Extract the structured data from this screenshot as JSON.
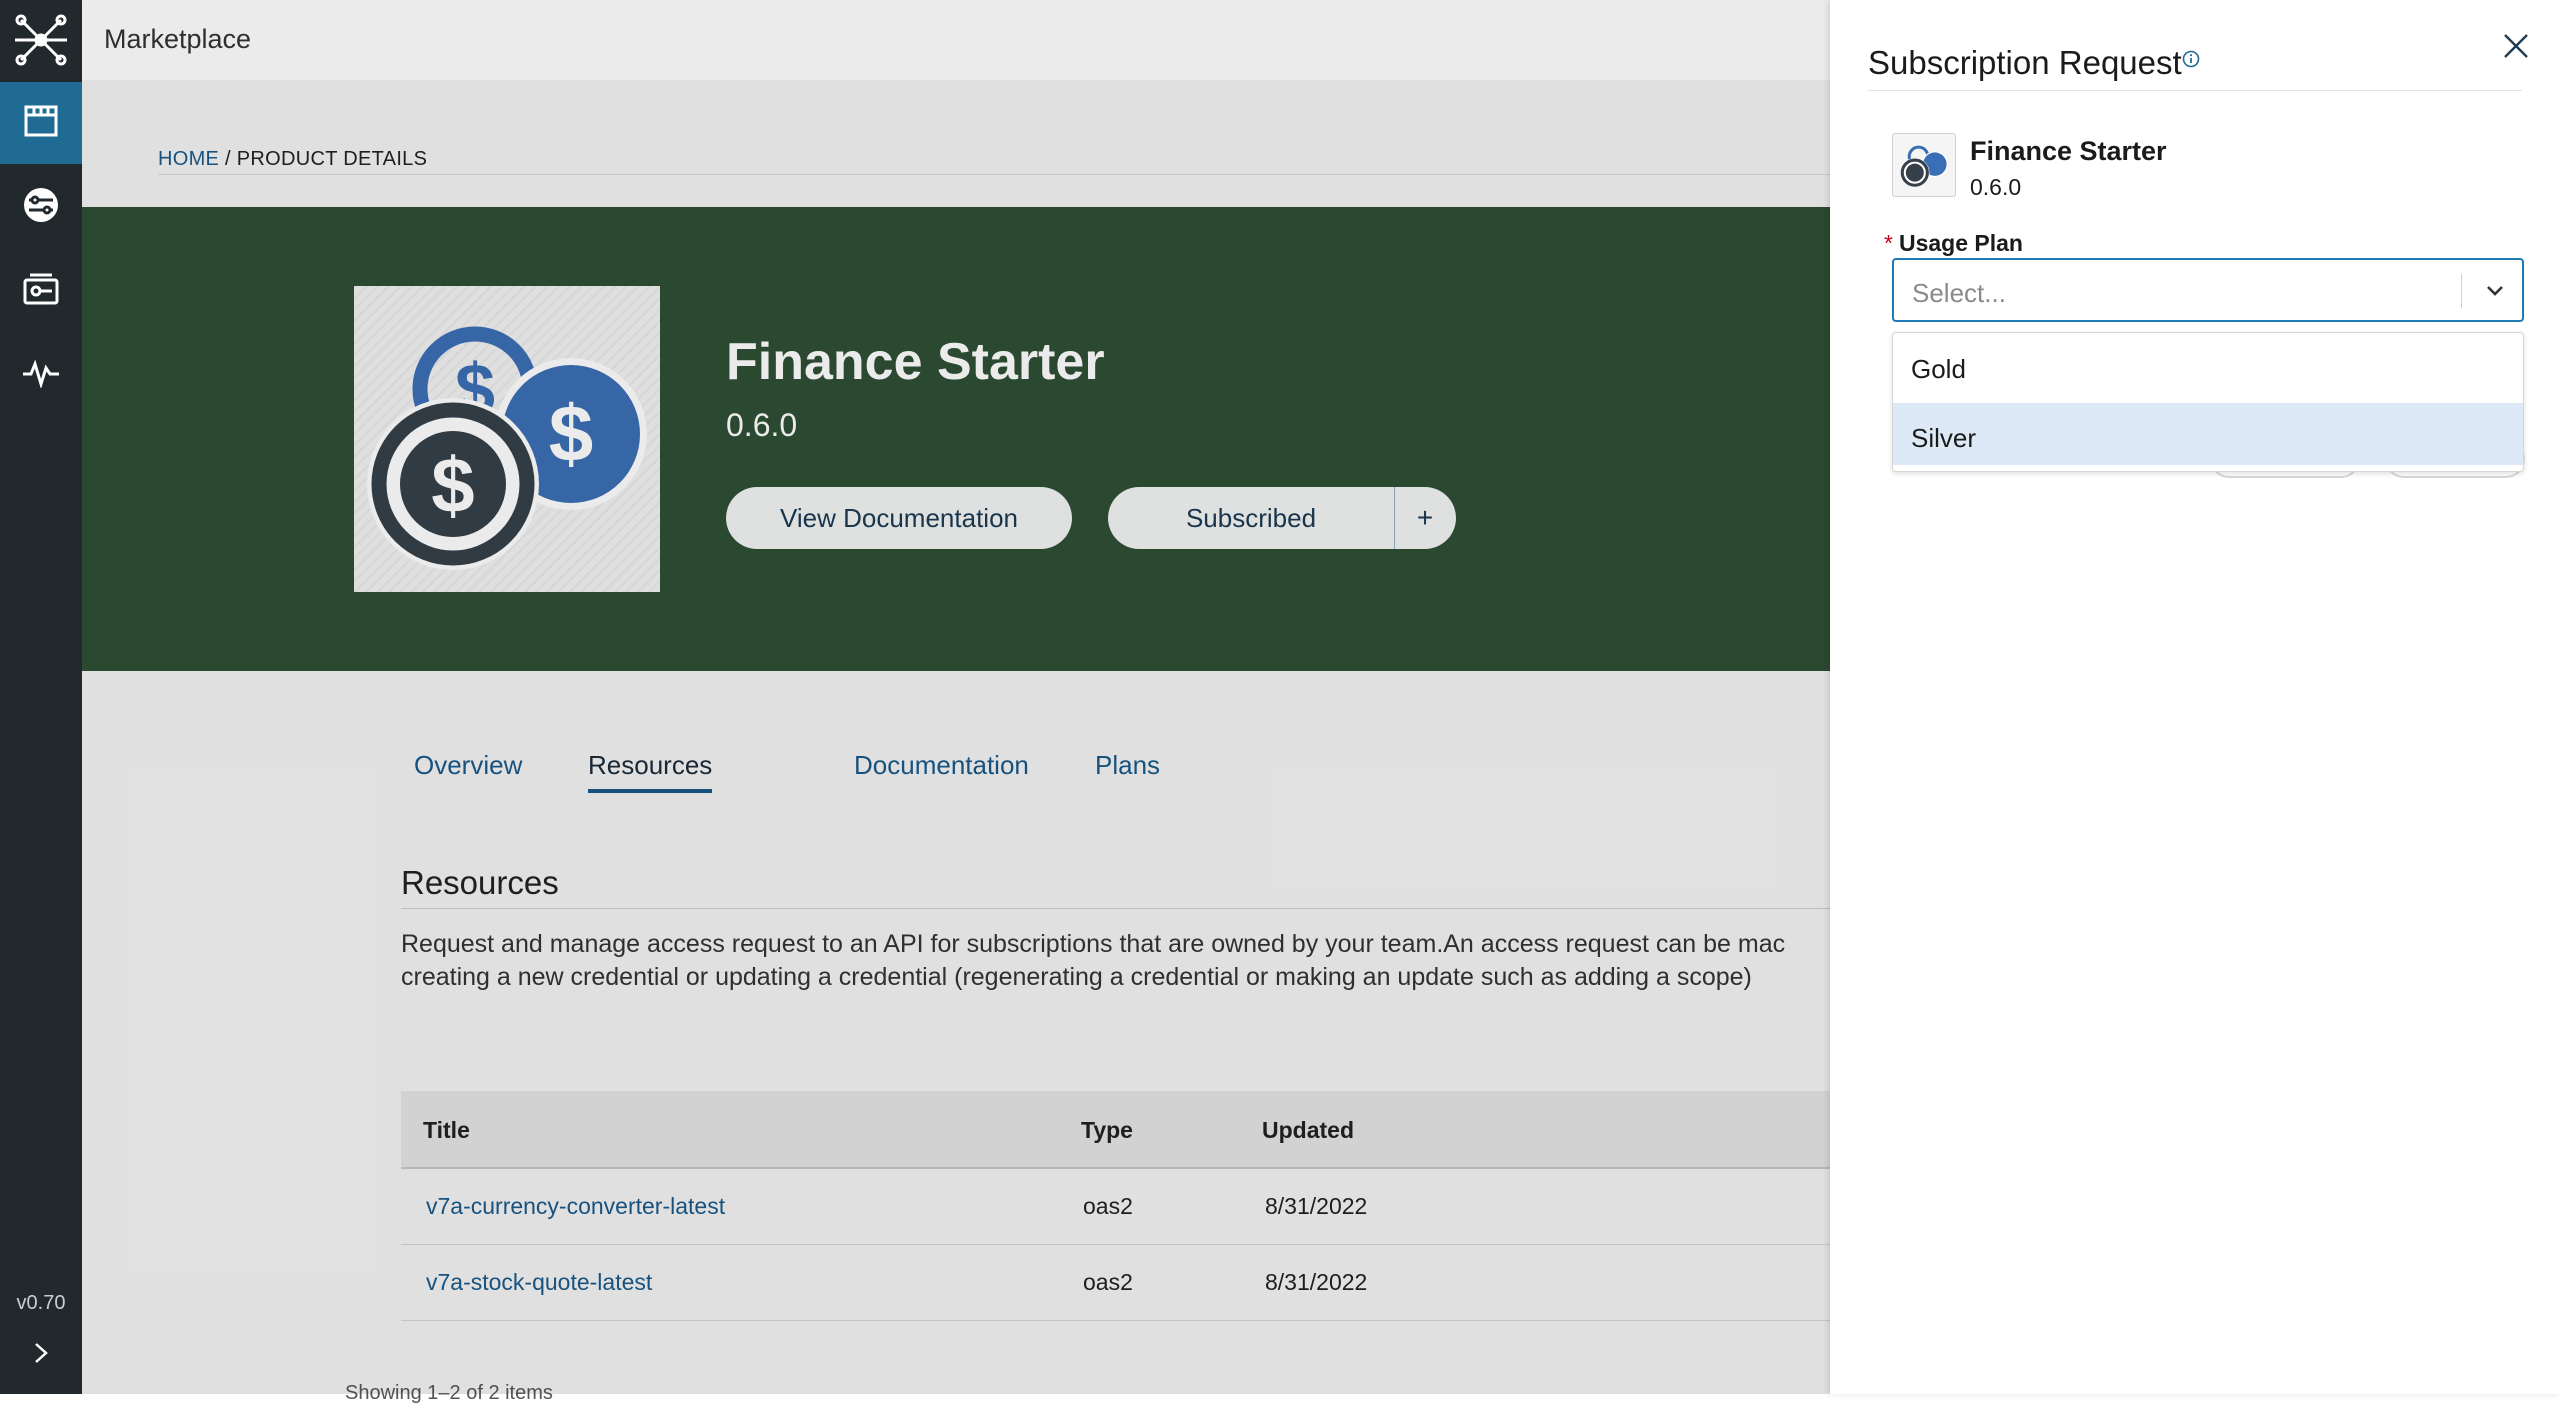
{
  "app": {
    "title": "Marketplace",
    "version": "v0.70"
  },
  "sidebar": {
    "items": [
      {
        "icon": "store-icon",
        "active": true
      },
      {
        "icon": "api-connection-icon",
        "active": false
      },
      {
        "icon": "credentials-icon",
        "active": false
      },
      {
        "icon": "activity-icon",
        "active": false
      }
    ]
  },
  "breadcrumb": {
    "home": "HOME",
    "separator": " / ",
    "current": "PRODUCT DETAILS"
  },
  "product": {
    "name": "Finance Starter",
    "version": "0.6.0",
    "view_docs_label": "View Documentation",
    "subscribed_label": "Subscribed",
    "add_label": "+"
  },
  "tabs": [
    {
      "label": "Overview",
      "active": false
    },
    {
      "label": "Resources",
      "active": true
    },
    {
      "label": "Documentation",
      "active": false
    },
    {
      "label": "Plans",
      "active": false
    }
  ],
  "resources": {
    "title": "Resources",
    "description_line1": "Request and manage access request to an API for subscriptions that are owned by your team.An access request can be mac",
    "description_line2": "creating a new credential or updating a credential (regenerating a credential or making an update such as adding a scope)",
    "columns": [
      "Title",
      "Type",
      "Updated"
    ],
    "rows": [
      {
        "title": "v7a-currency-converter-latest",
        "type": "oas2",
        "updated": "8/31/2022"
      },
      {
        "title": "v7a-stock-quote-latest",
        "type": "oas2",
        "updated": "8/31/2022"
      }
    ],
    "pager_hint": "Showing 1–2 of 2 items"
  },
  "drawer": {
    "title": "Subscription Request",
    "product_name": "Finance Starter",
    "product_version": "0.6.0",
    "usage_plan_label": "Usage Plan",
    "required_mark": "*",
    "select_placeholder": "Select...",
    "options": [
      {
        "label": "Gold",
        "highlighted": false
      },
      {
        "label": "Silver",
        "highlighted": true
      }
    ]
  },
  "colors": {
    "sidebar_bg": "#22292d",
    "sidebar_active": "#1f6b93",
    "hero_bg": "#2f4f35",
    "link": "#1a5a8a",
    "select_focus": "#1f7ab5",
    "option_highlight": "#dde9f7",
    "required": "#d0021b"
  }
}
